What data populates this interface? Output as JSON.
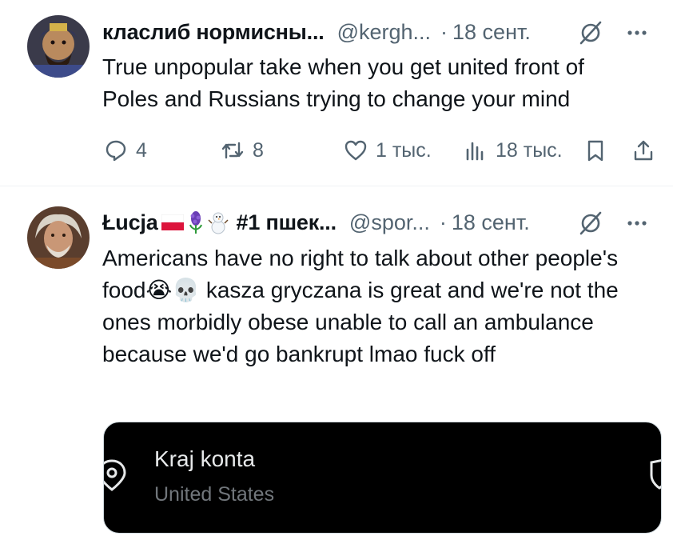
{
  "tweets": [
    {
      "author_name": "класлиб нормисны...",
      "handle": "@kergh...",
      "dot": "·",
      "time": "18 сент.",
      "text": "True unpopular take when you get united front of Poles and Russians trying to change your mind",
      "actions": {
        "replies": "4",
        "reposts": "8",
        "likes": "1 тыс.",
        "views": "18 тыс."
      }
    },
    {
      "author_name": "Łucja",
      "name_suffix": "#1 пшек...",
      "name_emojis": [
        "flag-poland-icon",
        "hyacinth-icon",
        "snowman-icon"
      ],
      "handle": "@spor...",
      "dot": "·",
      "time": "18 сент.",
      "text": "Americans have no right to talk about other people's food😭💀 kasza gryczana is great and we're not the ones morbidly obese unable to call an ambulance because we'd go bankrupt lmao fuck off",
      "card": {
        "title": "Kraj konta",
        "subtitle": "United States"
      }
    }
  ],
  "colors": {
    "text": "#0f1419",
    "secondary": "#536471",
    "card_bg": "#000000"
  }
}
